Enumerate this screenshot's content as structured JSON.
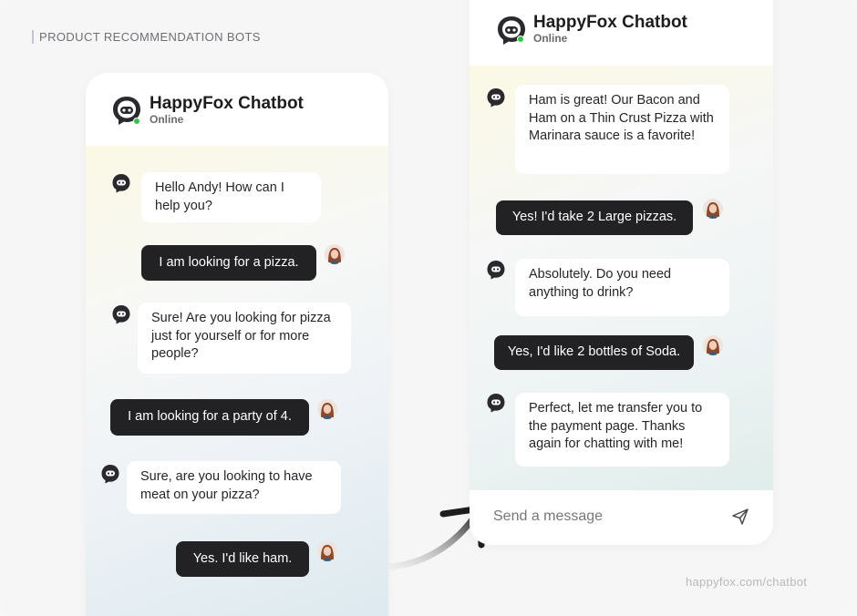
{
  "section_label": "PRODUCT RECOMMENDATION BOTS",
  "footer_url": "happyfox.com/chatbot",
  "left_chat": {
    "header": {
      "title": "HappyFox Chatbot",
      "status": "Online"
    },
    "messages": [
      {
        "from": "bot",
        "text": "Hello Andy! How can I help you?"
      },
      {
        "from": "user",
        "text": "I am looking for a pizza."
      },
      {
        "from": "bot",
        "text": "Sure! Are you looking for pizza just for yourself or for more people?"
      },
      {
        "from": "user",
        "text": "I am looking for a party of 4."
      },
      {
        "from": "bot",
        "text": "Sure, are you looking to have meat on your pizza?"
      },
      {
        "from": "user",
        "text": "Yes. I'd like ham."
      }
    ]
  },
  "right_chat": {
    "header": {
      "title": "HappyFox Chatbot",
      "status": "Online"
    },
    "messages": [
      {
        "from": "bot",
        "text": "Ham is great! Our Bacon and Ham on a Thin Crust Pizza with Marinara sauce is a favorite!"
      },
      {
        "from": "user",
        "text": "Yes! I'd take 2 Large pizzas."
      },
      {
        "from": "bot",
        "text": "Absolutely. Do you need anything to drink?"
      },
      {
        "from": "user",
        "text": "Yes, I'd like 2 bottles of Soda."
      },
      {
        "from": "bot",
        "text": "Perfect, let me transfer you to the payment page. Thanks again for chatting with me!"
      }
    ],
    "composer": {
      "placeholder": "Send a message",
      "send_icon": "send-icon"
    }
  },
  "colors": {
    "accent_dark": "#222224",
    "online": "#35c24a",
    "section_bar": "#c9c2d4"
  }
}
